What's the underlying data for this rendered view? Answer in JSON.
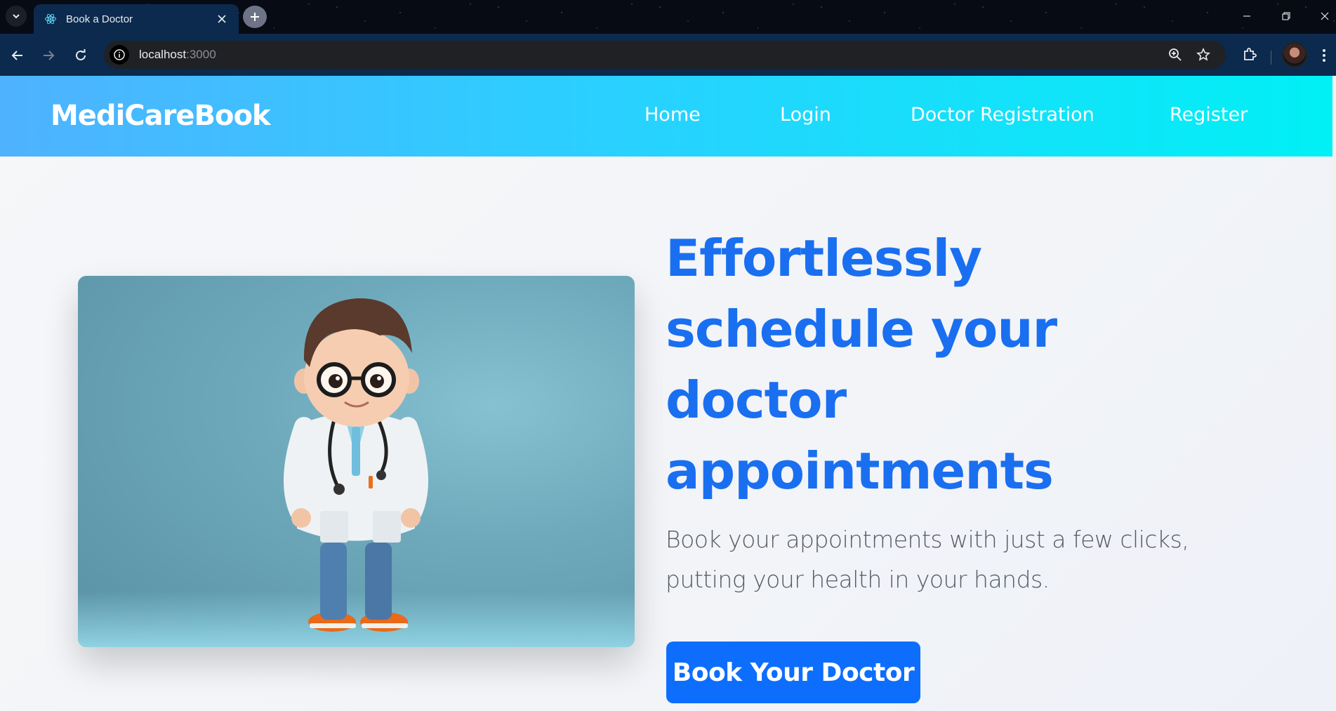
{
  "browser": {
    "tab_title": "Book a Doctor",
    "url_host": "localhost",
    "url_port": ":3000"
  },
  "site": {
    "brand": "MediCareBook",
    "nav": {
      "home": "Home",
      "login": "Login",
      "doctor_registration": "Doctor Registration",
      "register": "Register"
    }
  },
  "hero": {
    "headline": "Effortlessly schedule your doctor appointments",
    "subtext": "Book your appointments with just a few clicks, putting your health in your hands.",
    "cta_label": "Book Your Doctor",
    "image_icon": "cartoon-doctor-illustration"
  },
  "colors": {
    "nav_gradient_start": "#4fb2ff",
    "nav_gradient_end": "#00f0f5",
    "headline": "#1a6ff0",
    "cta": "#0d6efd"
  }
}
